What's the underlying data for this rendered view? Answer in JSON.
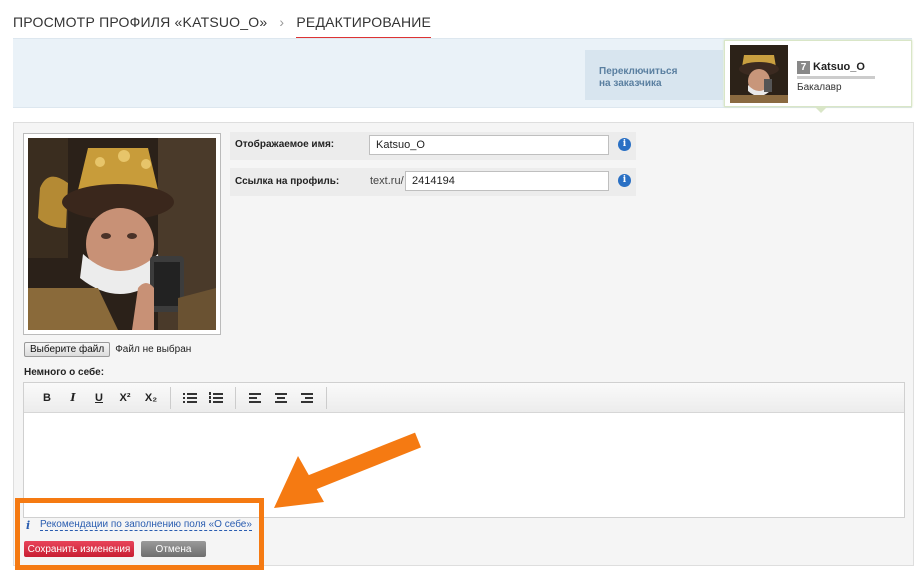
{
  "breadcrumb": {
    "item1": "ПРОСМОТР ПРОФИЛЯ «KATSUO_O»",
    "separator": "›",
    "current": "РЕДАКТИРОВАНИЕ"
  },
  "header": {
    "switch_label_1": "Переключиться",
    "switch_label_2": "на заказчика"
  },
  "user_card": {
    "level": "7",
    "username": "Katsuo_O",
    "rank": "Бакалавр",
    "progress": 0.0
  },
  "upload": {
    "button_label": "Выберите файл",
    "status": "Файл не выбран"
  },
  "form": {
    "display_name_label": "Отображаемое имя:",
    "display_name_value": "Katsuo_O",
    "profile_link_label": "Ссылка на профиль:",
    "profile_link_prefix": "text.ru/",
    "profile_link_value": "2414194"
  },
  "about": {
    "label": "Немного о себе:"
  },
  "toolbar": {
    "bold": "B",
    "italic": "I",
    "underline": "U",
    "superscript": "X²",
    "subscript": "X₂"
  },
  "recommendation": {
    "icon": "i",
    "link": "Рекомендации по заполнению поля «О себе»"
  },
  "actions": {
    "save_label": "Сохранить изменения",
    "cancel_label": "Отмена"
  },
  "colors": {
    "highlight": "#f57a12",
    "save": "#d62a3e",
    "link": "#2a5db0",
    "info": "#2a70c4"
  }
}
